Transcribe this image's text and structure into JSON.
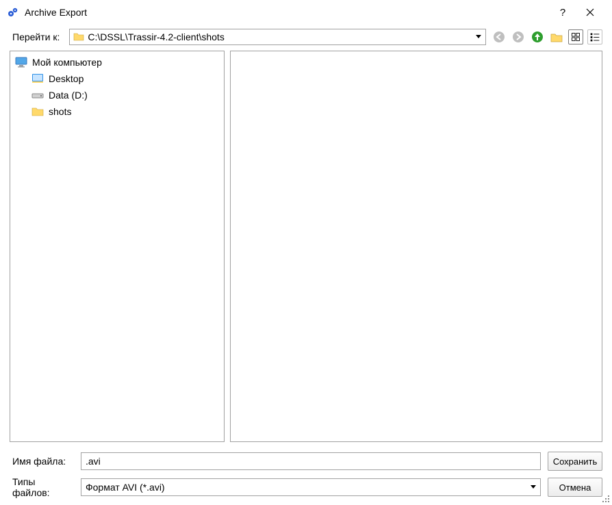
{
  "titlebar": {
    "title": "Archive Export"
  },
  "nav": {
    "goto_label": "Перейти к:",
    "path": "C:\\DSSL\\Trassir-4.2-client\\shots"
  },
  "tree": {
    "items": [
      {
        "label": "Мой компьютер",
        "icon": "monitor"
      },
      {
        "label": "Desktop",
        "icon": "desktop"
      },
      {
        "label": "Data (D:)",
        "icon": "drive"
      },
      {
        "label": "shots",
        "icon": "folder"
      }
    ]
  },
  "form": {
    "filename_label": "Имя файла:",
    "filename_value": ".avi",
    "filetype_label": "Типы файлов:",
    "filetype_value": "Формат AVI (*.avi)",
    "save_label": "Сохранить",
    "cancel_label": "Отмена"
  }
}
